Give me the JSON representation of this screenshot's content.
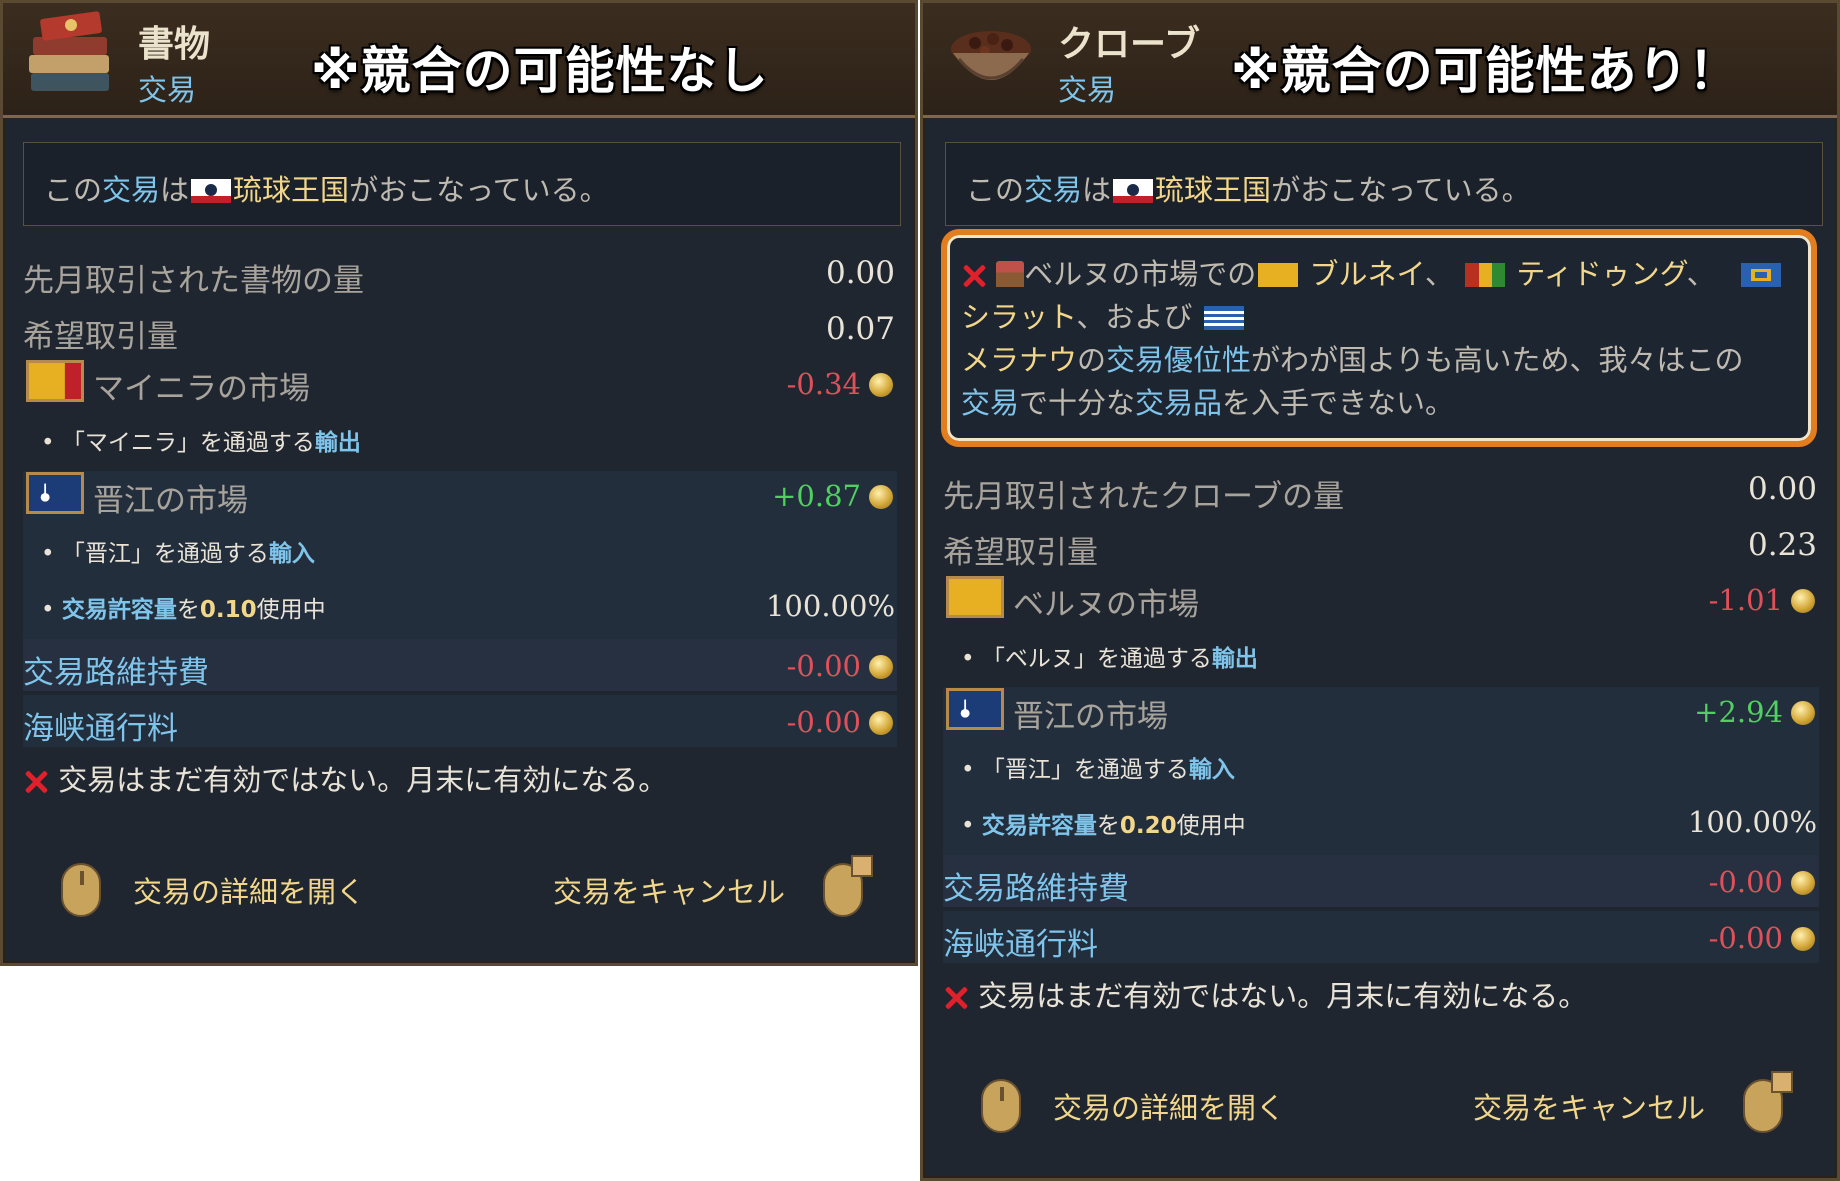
{
  "left": {
    "title": "書物",
    "subtitle": "交易",
    "note": "※競合の可能性なし",
    "notice": {
      "pre": "この",
      "kw": "交易",
      "mid": "は",
      "country": "琉球王国",
      "post": "がおこなっている。"
    },
    "traded_last_month_label": "先月取引された書物の量",
    "traded_last_month_value": "0.00",
    "desired_label": "希望取引量",
    "desired_value": "0.07",
    "market1": {
      "name": "マイニラの市場",
      "value": "-0.34",
      "bullet_pre": "「マイニラ」を通過する",
      "bullet_kw": "輸出"
    },
    "market2": {
      "name": "晋江の市場",
      "value": "+0.87",
      "bullet_pre": "「晋江」を通過する",
      "bullet_kw": "輸入",
      "cap_kw": "交易許容量",
      "cap_mid": "を",
      "cap_val": "0.10",
      "cap_post": "使用中",
      "cap_pct": "100.00%"
    },
    "upkeep_label": "交易路維持費",
    "upkeep_value": "-0.00",
    "strait_label": "海峡通行料",
    "strait_value": "-0.00",
    "status": "交易はまだ有効ではない。月末に有効になる。",
    "open_details": "交易の詳細を開く",
    "cancel": "交易をキャンセル"
  },
  "right": {
    "title": "クローブ",
    "subtitle": "交易",
    "note": "※競合の可能性あり！",
    "notice": {
      "pre": "この",
      "kw": "交易",
      "mid": "は",
      "country": "琉球王国",
      "post": "がおこなっている。"
    },
    "warning": {
      "l1_a": "ベルヌの市場での",
      "c1": "ブルネイ",
      "sep1": "、",
      "c2": "ティドゥング",
      "sep2": "、",
      "c3": "シラット",
      "l2_mid": "、および",
      "c4": "メラナウ",
      "l3_a": "の",
      "kw1": "交易優位性",
      "l3_b": "がわが国よりも高いため、我々はこの",
      "kw2": "交易",
      "l4_a": "で十分な",
      "kw3": "交易品",
      "l4_b": "を入手できない。"
    },
    "traded_last_month_label": "先月取引されたクローブの量",
    "traded_last_month_value": "0.00",
    "desired_label": "希望取引量",
    "desired_value": "0.23",
    "market1": {
      "name": "ベルヌの市場",
      "value": "-1.01",
      "bullet_pre": "「ベルヌ」を通過する",
      "bullet_kw": "輸出"
    },
    "market2": {
      "name": "晋江の市場",
      "value": "+2.94",
      "bullet_pre": "「晋江」を通過する",
      "bullet_kw": "輸入",
      "cap_kw": "交易許容量",
      "cap_mid": "を",
      "cap_val": "0.20",
      "cap_post": "使用中",
      "cap_pct": "100.00%"
    },
    "upkeep_label": "交易路維持費",
    "upkeep_value": "-0.00",
    "strait_label": "海峡通行料",
    "strait_value": "-0.00",
    "status": "交易はまだ有効ではない。月末に有効になる。",
    "open_details": "交易の詳細を開く",
    "cancel": "交易をキャンセル"
  },
  "colors": {
    "accent": "#7fc4ea",
    "gold": "#f2d68a",
    "negative": "#e0505a",
    "positive": "#4fd060",
    "warning_border": "#e37e1e"
  },
  "icons": [
    "books-icon",
    "cloves-bowl-icon",
    "flag-icon",
    "coin-icon",
    "x-icon",
    "market-stall-icon",
    "mouse-left-icon",
    "mouse-right-icon"
  ]
}
